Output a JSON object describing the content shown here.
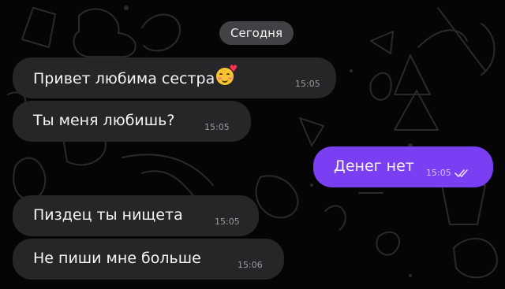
{
  "date_chip": "Сегодня",
  "messages": [
    {
      "text": "Привет любима сестра",
      "time": "15:05",
      "emoji": "smiling-face-with-hearts-icon",
      "direction": "incoming"
    },
    {
      "text": "Ты меня любишь?",
      "time": "15:05",
      "direction": "incoming"
    },
    {
      "text": "Денег нет",
      "time": "15:05",
      "direction": "outgoing",
      "status": "read"
    },
    {
      "text": "Пиздец ты нищета",
      "time": "15:05",
      "direction": "incoming"
    },
    {
      "text": "Не пиши мне больше",
      "time": "15:06",
      "direction": "incoming"
    }
  ],
  "colors": {
    "background": "#050505",
    "incoming_bubble": "#262628",
    "outgoing_bubble": "#7a3ff2",
    "date_chip": "#4e4e52"
  }
}
